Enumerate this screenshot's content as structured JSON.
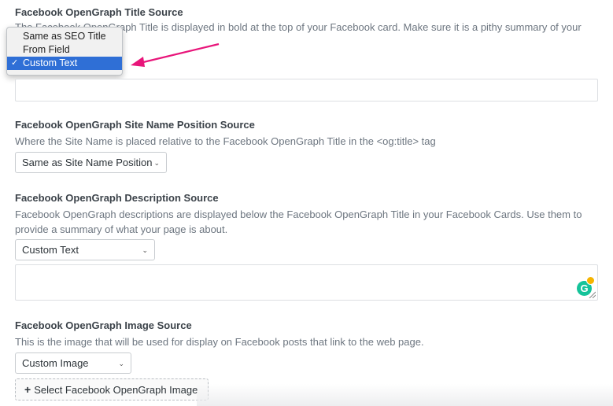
{
  "title_source": {
    "label": "Facebook OpenGraph Title Source",
    "description": "The Facebook OpenGraph Title is displayed in bold at the top of your Facebook card. Make sure it is a pithy summary of your",
    "dropdown_options": [
      {
        "label": "Same as SEO Title",
        "selected": false
      },
      {
        "label": "From Field",
        "selected": false
      },
      {
        "label": "Custom Text",
        "selected": true
      }
    ],
    "check_glyph": "✓",
    "text_value": ""
  },
  "site_name_position": {
    "label": "Facebook OpenGraph Site Name Position Source",
    "description": "Where the Site Name is placed relative to the Facebook OpenGraph Title in the <og:title> tag",
    "select_value": "Same as Site Name Position"
  },
  "description_source": {
    "label": "Facebook OpenGraph Description Source",
    "description_line1": "Facebook OpenGraph descriptions are displayed below the Facebook OpenGraph Title in your Facebook Cards. Use them to",
    "description_line2": "provide a summary of what your page is about.",
    "select_value": "Custom Text",
    "text_value": ""
  },
  "image_source": {
    "label": "Facebook OpenGraph Image Source",
    "description": "This is the image that will be used for display on Facebook posts that link to the web page.",
    "select_value": "Custom Image",
    "button_label": "Select Facebook OpenGraph Image"
  },
  "icons": {
    "chevron": "chevron-down-icon",
    "plus": "plus-icon",
    "grammarly": "grammarly-icon",
    "annotation_arrow": "pink-arrow-icon"
  },
  "colors": {
    "arrow": "#e8157a",
    "selected_option": "#2f6fd6",
    "grammarly": "#15c39a"
  }
}
